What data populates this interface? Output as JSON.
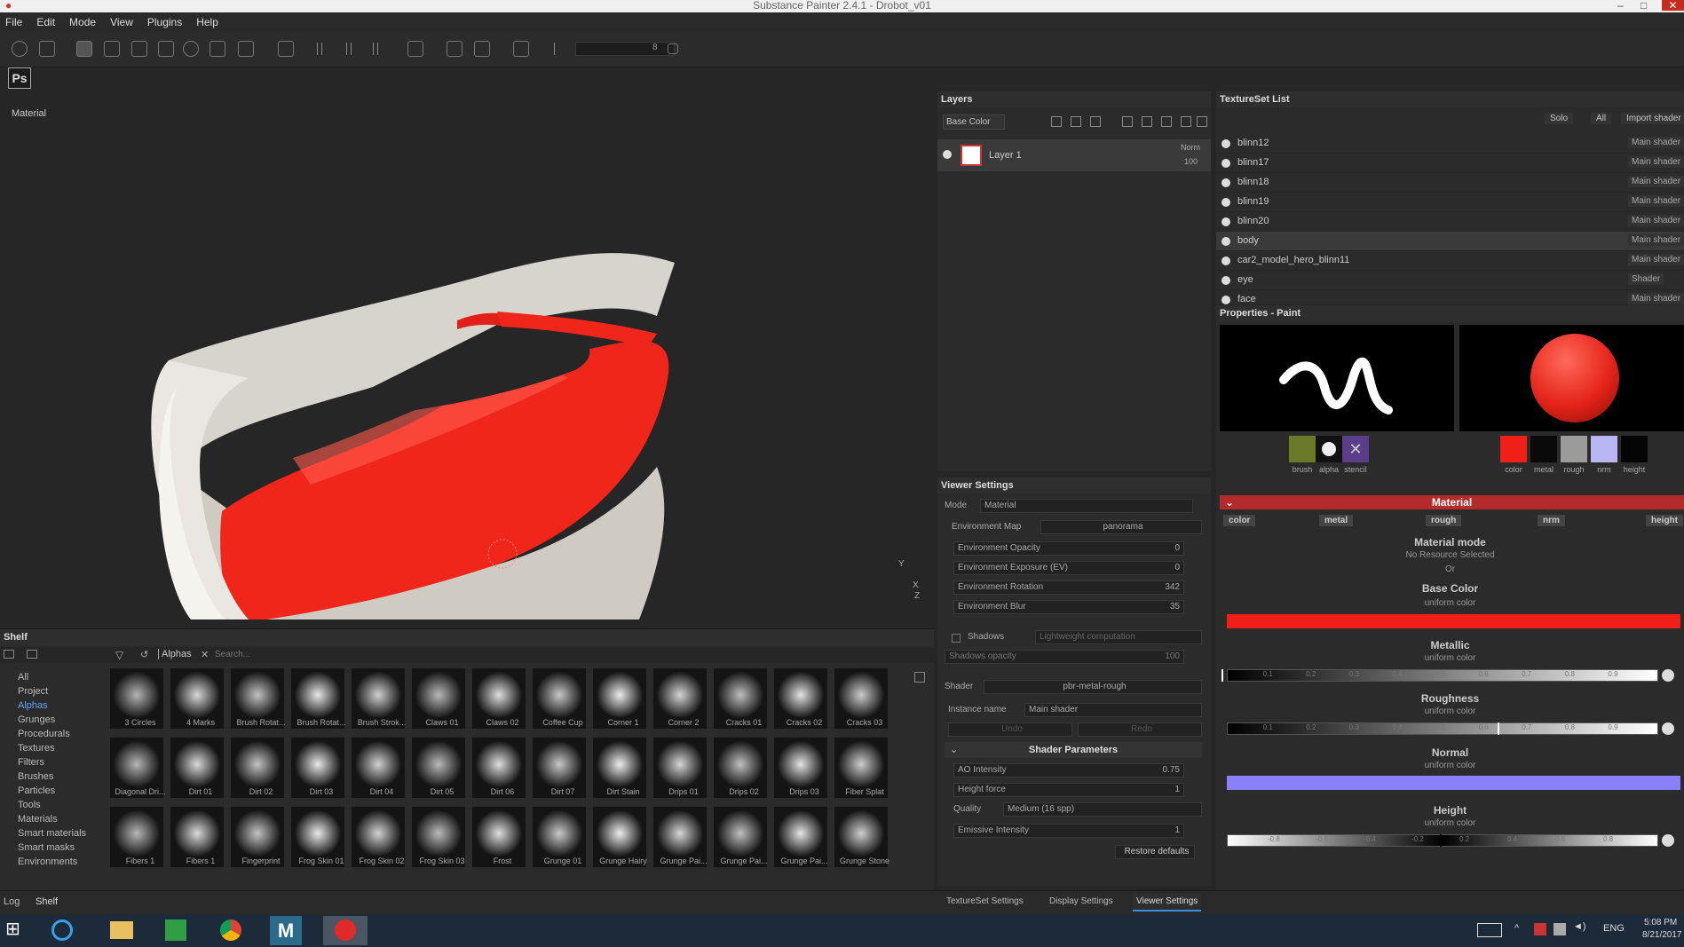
{
  "window": {
    "title": "Substance Painter 2.4.1 - Drobot_v01"
  },
  "menu": [
    "File",
    "Edit",
    "Mode",
    "View",
    "Plugins",
    "Help"
  ],
  "toolbar": {
    "slider_value": "8",
    "ps_label": "Ps"
  },
  "viewport": {
    "label": "Material",
    "axis_y": "Y",
    "axis_x": "X",
    "axis_z": "Z"
  },
  "layers": {
    "title": "Layers",
    "channel": "Base Color",
    "layer_name": "Layer 1",
    "blend": "Norm",
    "opacity": "100"
  },
  "viewer": {
    "title": "Viewer Settings",
    "mode_label": "Mode",
    "mode_value": "Material",
    "env_map_label": "Environment Map",
    "env_map_value": "panorama",
    "env_opacity_label": "Environment Opacity",
    "env_opacity_value": "0",
    "env_exposure_label": "Environment Exposure (EV)",
    "env_exposure_value": "0",
    "env_rotation_label": "Environment Rotation",
    "env_rotation_value": "342",
    "env_blur_label": "Environment Blur",
    "env_blur_value": "35",
    "shadows_label": "Shadows",
    "shadows_comp": "Lightweight computation",
    "shadows_opacity_label": "Shadows opacity",
    "shadows_opacity_value": "100",
    "shader_label": "Shader",
    "shader_value": "pbr-metal-rough",
    "instance_label": "Instance name",
    "instance_value": "Main shader",
    "undo": "Undo",
    "redo": "Redo",
    "shader_params": "Shader Parameters",
    "ao_label": "AO Intensity",
    "ao_value": "0.75",
    "height_label": "Height force",
    "height_value": "1",
    "quality_label": "Quality",
    "quality_value": "Medium (16 spp)",
    "emissive_label": "Emissive Intensity",
    "emissive_value": "1",
    "restore": "Restore defaults"
  },
  "texset": {
    "title": "TextureSet List",
    "solo": "Solo",
    "all": "All",
    "import": "Import shader",
    "rows": [
      {
        "name": "blinn12",
        "shader": "Main shader"
      },
      {
        "name": "blinn17",
        "shader": "Main shader"
      },
      {
        "name": "blinn18",
        "shader": "Main shader"
      },
      {
        "name": "blinn19",
        "shader": "Main shader"
      },
      {
        "name": "blinn20",
        "shader": "Main shader"
      },
      {
        "name": "body",
        "shader": "Main shader"
      },
      {
        "name": "car2_model_hero_blinn11",
        "shader": "Main shader"
      },
      {
        "name": "eye",
        "shader": "Shader"
      },
      {
        "name": "face",
        "shader": "Main shader"
      }
    ]
  },
  "props": {
    "title": "Properties - Paint",
    "brush_labels": [
      "brush",
      "alpha",
      "stencil"
    ],
    "mat_labels": [
      "color",
      "metal",
      "rough",
      "nrm",
      "height"
    ],
    "material_header": "Material",
    "channel_buttons": [
      "color",
      "metal",
      "rough",
      "nrm",
      "height"
    ],
    "material_mode": "Material mode",
    "no_resource": "No Resource Selected",
    "or": "Or",
    "base_color": "Base Color",
    "metallic": "Metallic",
    "roughness": "Roughness",
    "normal": "Normal",
    "height": "Height",
    "uniform": "uniform color",
    "colors": {
      "base": "#f01f17",
      "normal": "#8a80f8"
    },
    "ticks_01": [
      "0.1",
      "0.2",
      "0.3",
      "0.4",
      "0.5",
      "0.6",
      "0.7",
      "0.8",
      "0.9"
    ],
    "ticks_h": [
      "-0.8",
      "-0.6",
      "-0.4",
      "-0.2",
      "0.2",
      "0.4",
      "0.6",
      "0.8"
    ]
  },
  "shelf": {
    "title": "Shelf",
    "filter": "Alphas",
    "search_placeholder": "Search...",
    "categories": [
      "All",
      "Project",
      "Alphas",
      "Grunges",
      "Procedurals",
      "Textures",
      "Filters",
      "Brushes",
      "Particles",
      "Tools",
      "Materials",
      "Smart materials",
      "Smart masks",
      "Environments"
    ],
    "items": [
      "3 Circles",
      "4 Marks",
      "Brush Rotat...",
      "Brush Rotat...",
      "Brush Strok...",
      "Claws 01",
      "Claws 02",
      "Coffee Cup",
      "Corner 1",
      "Corner 2",
      "Cracks 01",
      "Cracks 02",
      "Cracks 03",
      "Diagonal Dri...",
      "Dirt 01",
      "Dirt 02",
      "Dirt 03",
      "Dirt 04",
      "Dirt 05",
      "Dirt 06",
      "Dirt 07",
      "Dirt Stain",
      "Drips 01",
      "Drips 02",
      "Drips 03",
      "Fiber Splat",
      "Fibers 1",
      "Fibers 1",
      "Fingerprint",
      "Frog Skin 01",
      "Frog Skin 02",
      "Frog Skin 03",
      "Frost",
      "Grunge 01",
      "Grunge Hairy",
      "Grunge Pai...",
      "Grunge Pai...",
      "Grunge Pai...",
      "Grunge Stone"
    ]
  },
  "bottom": {
    "log": "Log",
    "shelf": "Shelf",
    "tabs": [
      "TextureSet Settings",
      "Display Settings",
      "Viewer Settings"
    ]
  },
  "taskbar": {
    "lang": "ENG",
    "time": "5:08 PM",
    "date": "8/21/2017"
  }
}
